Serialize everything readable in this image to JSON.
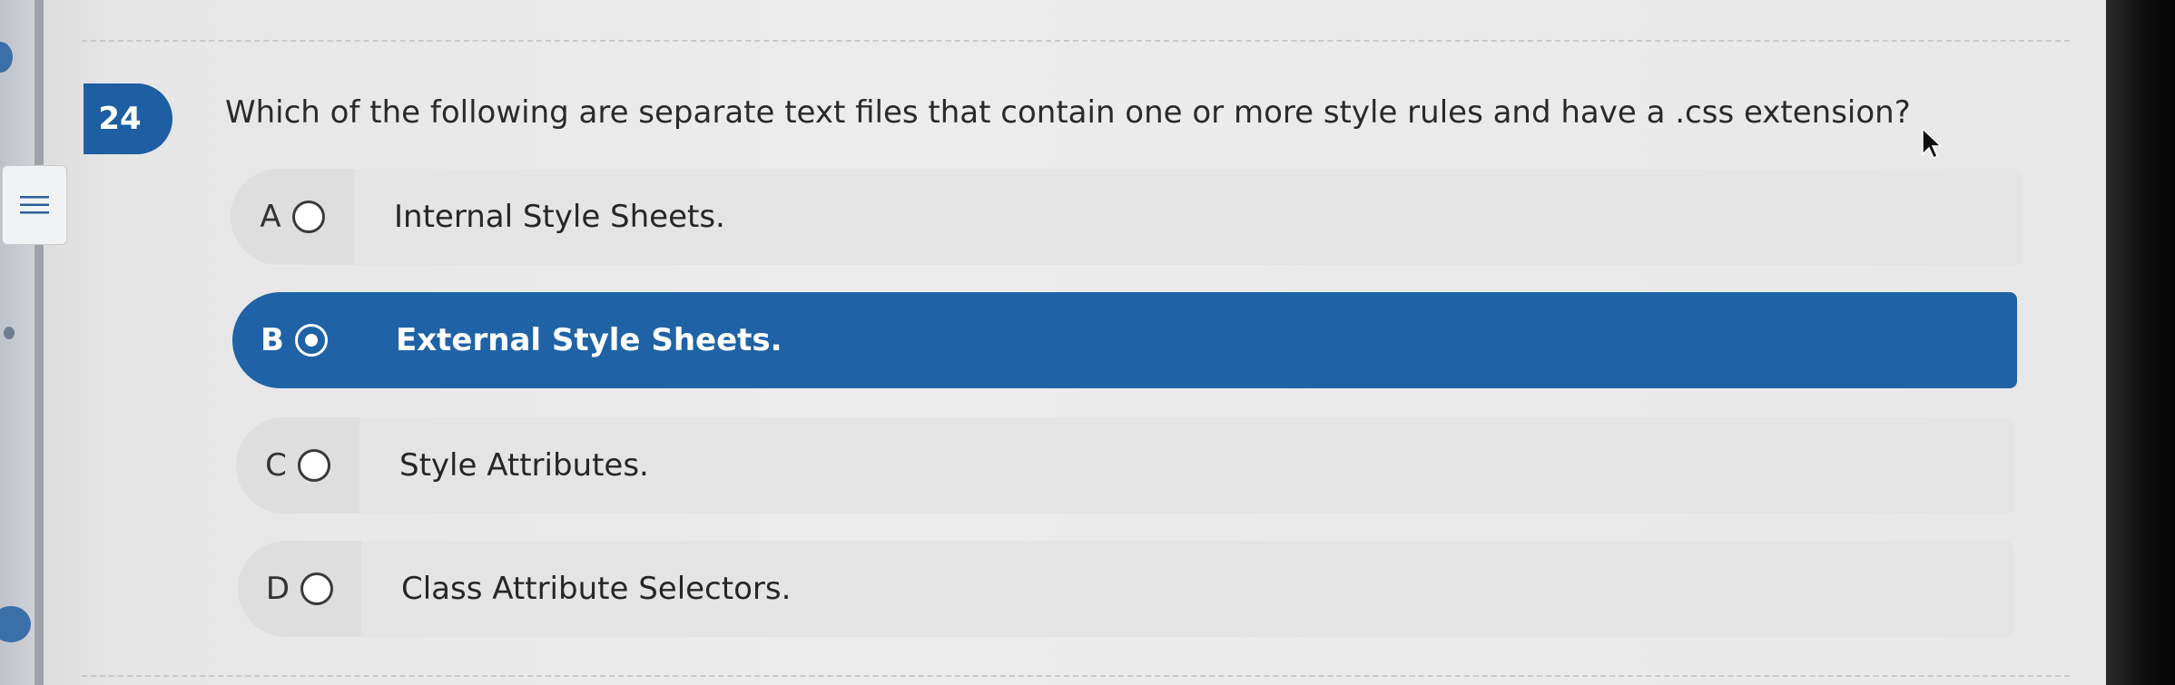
{
  "question": {
    "number": "24",
    "text": "Which of the following are separate text files that contain one or more style rules and have a .css extension?"
  },
  "options": [
    {
      "letter": "A",
      "text": "Internal Style Sheets.",
      "selected": false
    },
    {
      "letter": "B",
      "text": "External Style Sheets.",
      "selected": true
    },
    {
      "letter": "C",
      "text": "Style Attributes.",
      "selected": false
    },
    {
      "letter": "D",
      "text": "Class Attribute Selectors.",
      "selected": false
    }
  ],
  "colors": {
    "accent": "#1f63a6",
    "option_bg": "#e4e4e4",
    "option_tab_bg": "#dedede"
  },
  "icons": {
    "menu": "hamburger-menu-icon",
    "cursor": "mouse-pointer-icon",
    "radio": "radio-button-icon"
  }
}
